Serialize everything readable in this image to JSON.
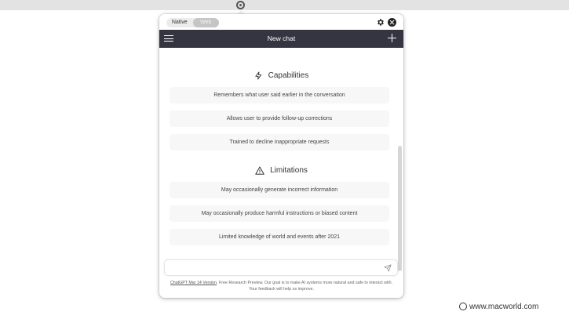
{
  "toolbar": {
    "segments": [
      "Native",
      "Web"
    ],
    "active_segment": "Web"
  },
  "nav": {
    "title": "New chat"
  },
  "capabilities": {
    "title": "Capabilities",
    "items": [
      "Remembers what user said earlier in the conversation",
      "Allows user to provide follow-up corrections",
      "Trained to decline inappropriate requests"
    ]
  },
  "limitations": {
    "title": "Limitations",
    "items": [
      "May occasionally generate incorrect information",
      "May occasionally produce harmful instructions or biased content",
      "Limited knowledge of world and events after 2021"
    ]
  },
  "composer": {
    "placeholder": ""
  },
  "footer": {
    "link": "ChatGPT Mar 14 Version",
    "text": ". Free Research Preview. Our goal is to make AI systems more natural and safe to interact with. Your feedback will help us improve."
  },
  "watermark": {
    "text": "www.macworld.com"
  }
}
